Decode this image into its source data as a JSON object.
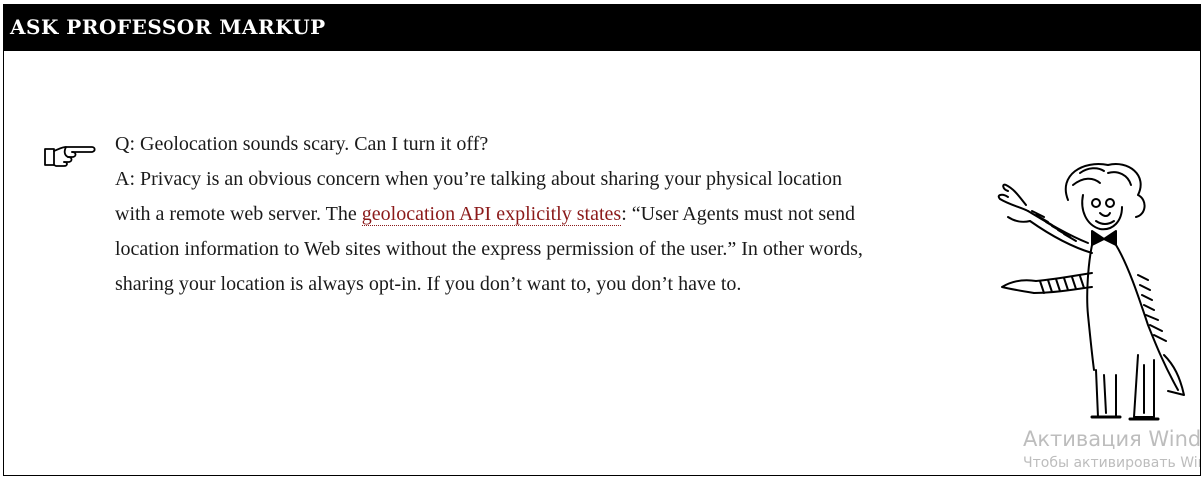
{
  "header": {
    "title": "ASK PROFESSOR MARKUP"
  },
  "icons": {
    "pointer": "pointing-hand-icon",
    "illustration": "professor-markup-illustration"
  },
  "qa": {
    "question": "Q: Geolocation sounds scary. Can I turn it off?",
    "answer_prefix": "A: Privacy is an obvious concern when you’re talking about sharing your physical location with a remote web server. The ",
    "link_text": "geolocation API explicitly states",
    "answer_suffix": ": “User Agents must not send location information to Web sites without the express permission of the user.” In other words, sharing your location is always opt-in. If you don’t want to, you don’t have to."
  },
  "watermark": {
    "line1": "Активация Windows",
    "line2": "Чтобы активировать Windows"
  },
  "colors": {
    "header_bg": "#000000",
    "header_text": "#ffffff",
    "link": "#8b1a1a",
    "watermark": "#bdbdbd"
  }
}
